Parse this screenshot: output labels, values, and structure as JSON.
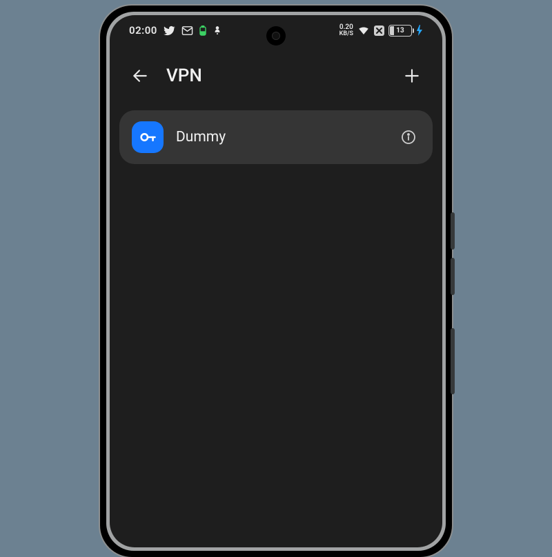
{
  "statusbar": {
    "time": "02:00",
    "data_rate_value": "0.20",
    "data_rate_unit": "KB/S",
    "battery_percent": "13"
  },
  "appbar": {
    "title": "VPN"
  },
  "vpn_items": [
    {
      "name": "Dummy"
    }
  ],
  "colors": {
    "accent": "#1677ff",
    "screen_bg": "#1e1e1e",
    "card_bg": "#353535",
    "page_bg": "#6c8191"
  }
}
